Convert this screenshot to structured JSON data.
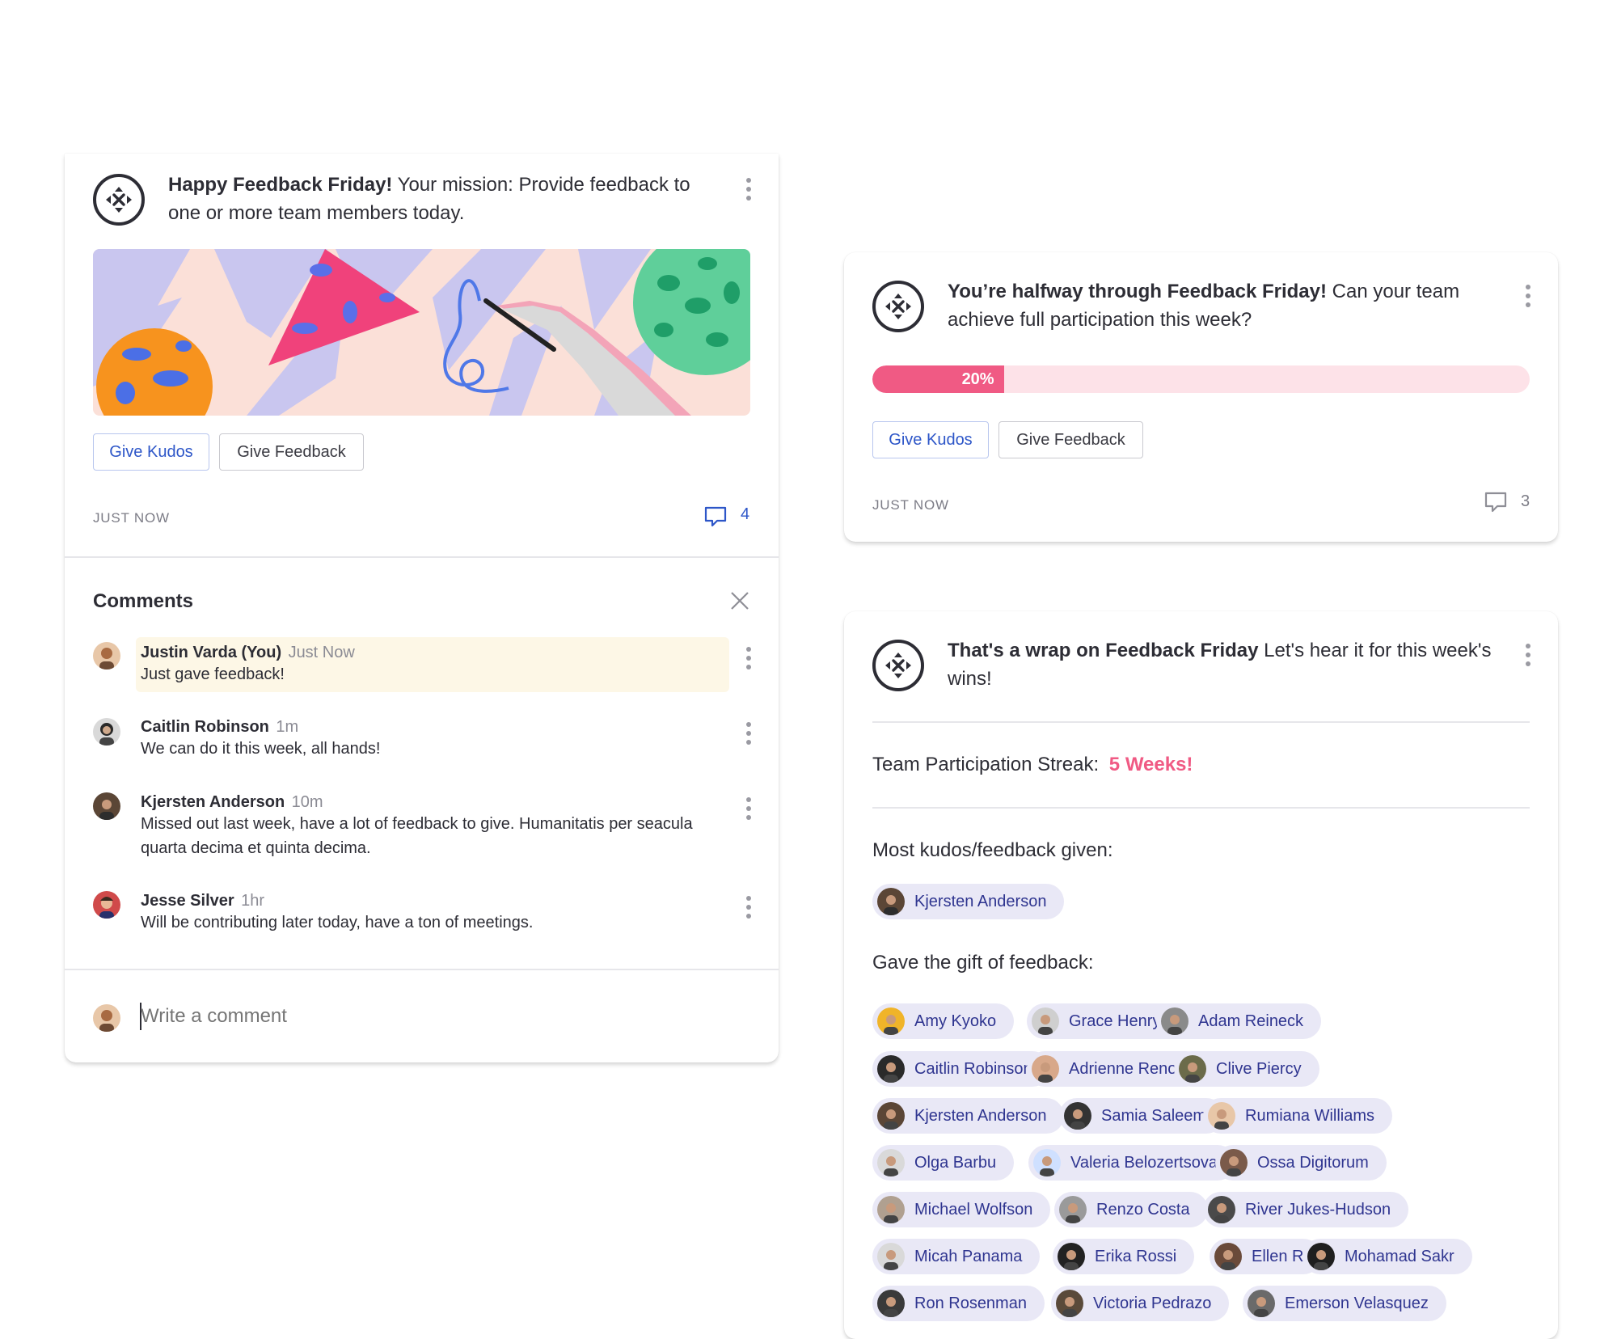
{
  "card1": {
    "title_bold": "Happy Feedback Friday!",
    "title_rest": " Your mission: Provide feedback to one or more team members today.",
    "kudos_label": "Give Kudos",
    "feedback_label": "Give Feedback",
    "timestamp": "JUST NOW",
    "comment_count": "4",
    "comments_heading": "Comments",
    "comments": [
      {
        "name": "Justin Varda (You)",
        "time": "Just Now",
        "text": "Just gave feedback!"
      },
      {
        "name": "Caitlin Robinson",
        "time": "1m",
        "text": "We can do it this week, all hands!"
      },
      {
        "name": "Kjersten Anderson",
        "time": "10m",
        "text": "Missed out last week, have a lot of feedback to give. Humanitatis per seacula quarta decima et quinta decima."
      },
      {
        "name": "Jesse Silver",
        "time": "1hr",
        "text": "Will be contributing later today, have a ton of meetings."
      }
    ],
    "comment_placeholder": "Write a comment"
  },
  "card2": {
    "title_bold": "You’re halfway through Feedback Friday!",
    "title_rest": " Can your team achieve full participation this week?",
    "progress": 0.2,
    "progress_label": "20%",
    "kudos_label": "Give Kudos",
    "feedback_label": "Give Feedback",
    "timestamp": "JUST NOW",
    "comment_count": "3"
  },
  "card3": {
    "title_bold": "That's a wrap on Feedback Friday",
    "title_rest": " Let's hear it for this week's wins!",
    "streak_label": "Team Participation Streak:",
    "streak_value": "5 Weeks!",
    "most_label": "Most kudos/feedback given:",
    "most_person": "Kjersten Anderson",
    "gift_label": "Gave the gift of feedback:",
    "people": [
      "Amy Kyoko",
      "Grace Henry Pincer",
      "Adam Reineck",
      "Caitlin Robinson",
      "Adrienne Renoir",
      "Clive Piercy",
      "Kjersten Anderson",
      "Samia Saleem",
      "Rumiana Williams",
      "Olga Barbu",
      "Valeria Belozertsova",
      "Ossa Digitorum",
      "Michael Wolfson",
      "Renzo Costa",
      "River Jukes-Hudson",
      "Micah Panama",
      "Erika Rossi",
      "Ellen R",
      "Mohamad Sakr",
      "Ron Rosenman",
      "Victoria Pedrazo",
      "Emerson Velasquez"
    ]
  },
  "colors": {
    "accent_pink": "#f05a84",
    "progress_track": "#fde2e8",
    "chip_bg": "#e9e8f6",
    "chip_text": "#2f3590",
    "link_blue": "#2d56c8",
    "comment_highlight": "#fdf7e6"
  },
  "icons": [
    "app-logo-icon",
    "kebab-menu-icon",
    "comment-bubble-icon",
    "close-icon"
  ]
}
